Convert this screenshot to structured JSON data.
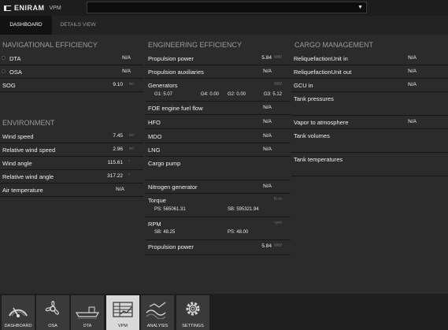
{
  "app": {
    "brand": "ENIRAM",
    "product": "VPM",
    "select_value": ""
  },
  "tabs": [
    {
      "label": "DASHBOARD",
      "active": true
    },
    {
      "label": "DETAILS VIEW",
      "active": false
    }
  ],
  "navigational": {
    "title": "NAVIGATIONAL EFFICIENCY",
    "rows": [
      {
        "label": "DTA",
        "value": "N/A",
        "unit": ""
      },
      {
        "label": "OSA",
        "value": "N/A",
        "unit": ""
      },
      {
        "label": "SOG",
        "value": "9.10",
        "unit": "kn"
      }
    ]
  },
  "environment": {
    "title": "ENVIRONMENT",
    "rows": [
      {
        "label": "Wind speed",
        "value": "7.45",
        "unit": "kn"
      },
      {
        "label": "Relative wind speed",
        "value": "2.96",
        "unit": "kn"
      },
      {
        "label": "Wind angle",
        "value": "115.61",
        "unit": "°"
      },
      {
        "label": "Relative wind angle",
        "value": "317.22",
        "unit": "°"
      },
      {
        "label": "Air temperature",
        "value": "N/A",
        "unit": ""
      }
    ]
  },
  "engineering": {
    "title": "ENGINEERING EFFICIENCY",
    "propulsion_power": {
      "label": "Propulsion power",
      "value": "5.84",
      "unit": "MW"
    },
    "propulsion_aux": {
      "label": "Propulsion auxiliaries",
      "value": "N/A"
    },
    "generators": {
      "label": "Generators",
      "unit": "MW",
      "g1": "G1: 5.07",
      "g4": "G4: 0.00",
      "g2": "G2: 0.00",
      "g3": "G3: 5.12"
    },
    "foe": {
      "label": "FOE engine fuel flow",
      "value": "N/A"
    },
    "hfo": {
      "label": "HFO",
      "value": "N/A"
    },
    "mdo": {
      "label": "MDO",
      "value": "N/A"
    },
    "lng": {
      "label": "LNG",
      "value": "N/A"
    },
    "cargo_pump": {
      "label": "Cargo pump"
    },
    "nitrogen": {
      "label": "Nitrogen generator",
      "value": "N/A"
    },
    "torque": {
      "label": "Torque",
      "unit": "N·m",
      "ps": "PS: 565061.31",
      "sb": "SB: 595321.94"
    },
    "rpm": {
      "label": "RPM",
      "unit": "rpm",
      "sb": "SB: 48.25",
      "ps": "PS: 48.00"
    },
    "propulsion_power2": {
      "label": "Propulsion power",
      "value": "5.84",
      "unit": "MW"
    }
  },
  "cargo": {
    "title": "CARGO MANAGEMENT",
    "liq_in": {
      "label": "ReliquefactionUnit in",
      "value": "N/A"
    },
    "liq_out": {
      "label": "ReliquefactionUnit out",
      "value": "N/A"
    },
    "gcu_in": {
      "label": "GCU in",
      "value": "N/A"
    },
    "tank_pressures": {
      "label": "Tank pressures"
    },
    "vapor": {
      "label": "Vapor to atmosphere",
      "value": "N/A"
    },
    "tank_volumes": {
      "label": "Tank volumes"
    },
    "tank_temperatures": {
      "label": "Tank temperatures"
    }
  },
  "nav": [
    {
      "label": "DASHBOARD",
      "icon": "gauge-icon",
      "active": false
    },
    {
      "label": "OSA",
      "icon": "propeller-icon",
      "active": false
    },
    {
      "label": "DTA",
      "icon": "ship-icon",
      "active": false
    },
    {
      "label": "VPM",
      "icon": "table-chart-icon",
      "active": true
    },
    {
      "label": "ANALYSIS",
      "icon": "wave-analysis-icon",
      "active": false
    },
    {
      "label": "SETTINGS",
      "icon": "gear-icon",
      "active": false
    }
  ]
}
